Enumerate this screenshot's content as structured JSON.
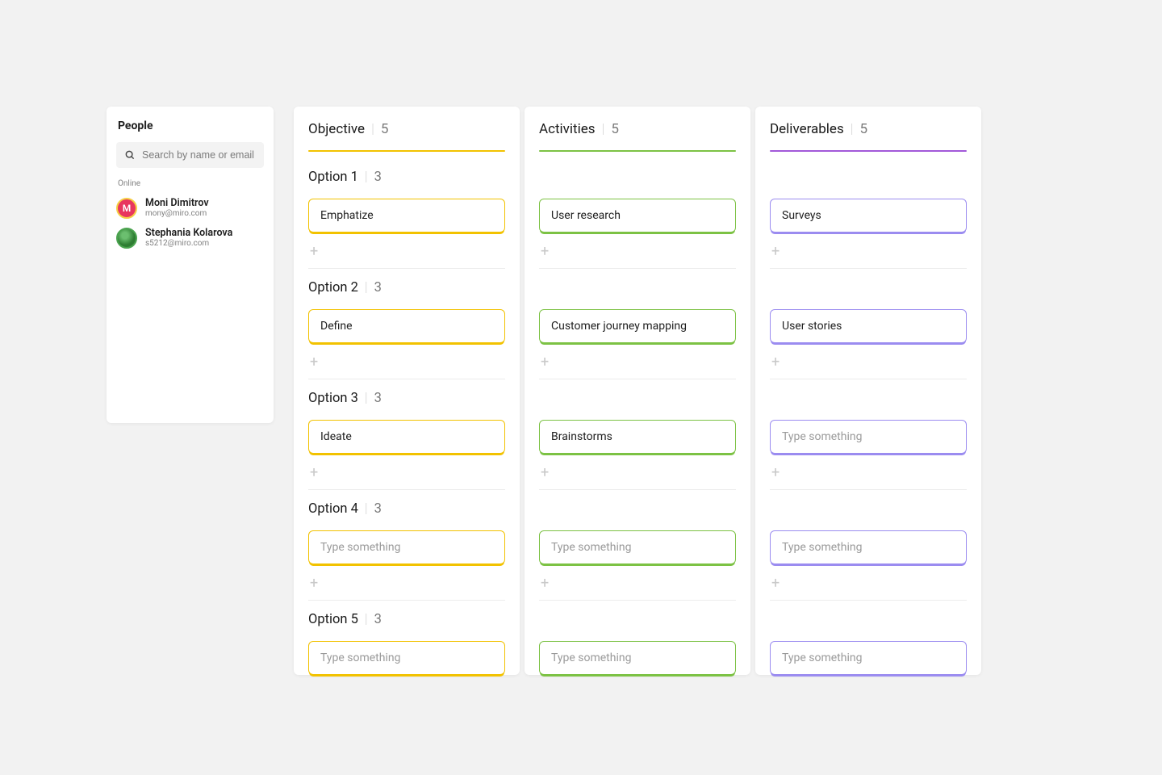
{
  "people_panel": {
    "title": "People",
    "search_placeholder": "Search by name or email",
    "status_label": "Online",
    "people": [
      {
        "initial": "M",
        "name": "Moni Dimitrov",
        "email": "mony@miro.com",
        "avatar_class": "avatar-m"
      },
      {
        "initial": "",
        "name": "Stephania Kolarova",
        "email": "s5212@miro.com",
        "avatar_class": "avatar-s"
      }
    ]
  },
  "columns": [
    {
      "id": "objective",
      "title": "Objective",
      "count": "5",
      "color": "yellow"
    },
    {
      "id": "activities",
      "title": "Activities",
      "count": "5",
      "color": "green"
    },
    {
      "id": "deliverables",
      "title": "Deliverables",
      "count": "5",
      "color": "purple"
    }
  ],
  "rows": [
    {
      "label": "Option 1",
      "count": "3",
      "cards": [
        {
          "text": "Emphatize",
          "placeholder": false
        },
        {
          "text": "User research",
          "placeholder": false
        },
        {
          "text": "Surveys",
          "placeholder": false
        }
      ]
    },
    {
      "label": "Option 2",
      "count": "3",
      "cards": [
        {
          "text": "Define",
          "placeholder": false
        },
        {
          "text": "Customer journey mapping",
          "placeholder": false
        },
        {
          "text": "User stories",
          "placeholder": false
        }
      ]
    },
    {
      "label": "Option 3",
      "count": "3",
      "cards": [
        {
          "text": "Ideate",
          "placeholder": false
        },
        {
          "text": "Brainstorms",
          "placeholder": false
        },
        {
          "text": "Type something",
          "placeholder": true
        }
      ]
    },
    {
      "label": "Option 4",
      "count": "3",
      "cards": [
        {
          "text": "Type something",
          "placeholder": true
        },
        {
          "text": "Type something",
          "placeholder": true
        },
        {
          "text": "Type something",
          "placeholder": true
        }
      ]
    },
    {
      "label": "Option 5",
      "count": "3",
      "cards": [
        {
          "text": "Type something",
          "placeholder": true
        },
        {
          "text": "Type something",
          "placeholder": true
        },
        {
          "text": "Type something",
          "placeholder": true
        }
      ]
    }
  ],
  "placeholder_text": "Type something"
}
